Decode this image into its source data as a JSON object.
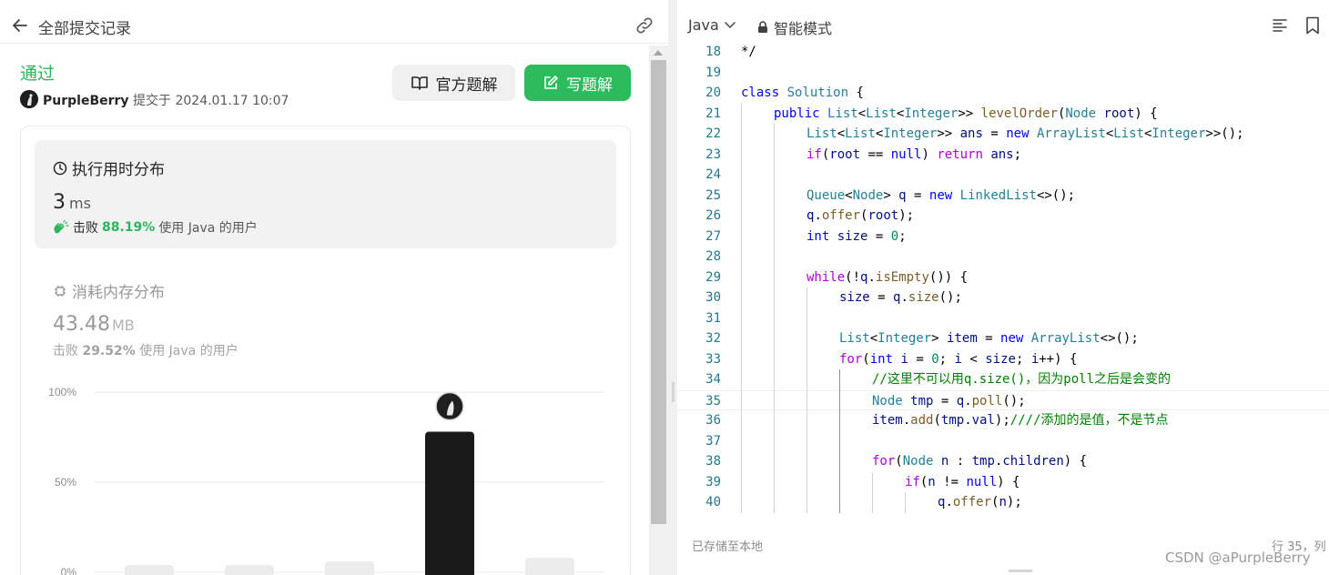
{
  "left": {
    "header_title": "全部提交记录",
    "status": "通过",
    "user_name": "PurpleBerry",
    "submitted_label": "提交于",
    "submitted_time": "2024.01.17 10:07",
    "btn_official": "官方题解",
    "btn_write": "写题解",
    "runtime": {
      "title": "执行用时分布",
      "value": "3",
      "unit": "ms",
      "beat_label": "击败",
      "beat_pct": "88.19%",
      "beat_suffix": "使用 Java 的用户"
    },
    "memory": {
      "title": "消耗内存分布",
      "value": "43.48",
      "unit": "MB",
      "beat_label": "击败",
      "beat_pct": "29.52%",
      "beat_suffix": "使用 Java 的用户"
    }
  },
  "chart_data": {
    "type": "bar",
    "ylim": [
      0,
      100
    ],
    "ytick_labels": [
      "100%",
      "50%",
      "0%"
    ],
    "yticks": [
      100,
      50,
      0
    ],
    "values": [
      4,
      4,
      6,
      78,
      8
    ],
    "highlight_index": 3,
    "colors": {
      "bar": "#ececec",
      "highlight": "#1a1a1a",
      "grid": "#ebebeb"
    }
  },
  "editor": {
    "language": "Java",
    "mode": "智能模式",
    "saved": "已存储至本地",
    "cursor": "行 35，列",
    "watermark": "CSDN @aPurpleBerry",
    "lines": [
      {
        "n": "18",
        "indent": 0,
        "t": [
          [
            "",
            "*/"
          ]
        ]
      },
      {
        "n": "19",
        "indent": 0,
        "t": []
      },
      {
        "n": "20",
        "indent": 0,
        "t": [
          [
            "kw",
            "class"
          ],
          [
            "",
            " "
          ],
          [
            "ty",
            "Solution"
          ],
          [
            "",
            " {"
          ]
        ]
      },
      {
        "n": "21",
        "indent": 1,
        "t": [
          [
            "kw",
            "public"
          ],
          [
            "",
            " "
          ],
          [
            "ty",
            "List"
          ],
          [
            "",
            "<"
          ],
          [
            "ty",
            "List"
          ],
          [
            "",
            "<"
          ],
          [
            "ty",
            "Integer"
          ],
          [
            "",
            ">> "
          ],
          [
            "fn",
            "levelOrder"
          ],
          [
            "",
            "("
          ],
          [
            "ty",
            "Node"
          ],
          [
            "",
            " "
          ],
          [
            "var",
            "root"
          ],
          [
            "",
            ") {"
          ]
        ]
      },
      {
        "n": "22",
        "indent": 2,
        "t": [
          [
            "ty",
            "List"
          ],
          [
            "",
            "<"
          ],
          [
            "ty",
            "List"
          ],
          [
            "",
            "<"
          ],
          [
            "ty",
            "Integer"
          ],
          [
            "",
            ">> "
          ],
          [
            "var",
            "ans"
          ],
          [
            "",
            " = "
          ],
          [
            "kw",
            "new"
          ],
          [
            "",
            " "
          ],
          [
            "ty",
            "ArrayList"
          ],
          [
            "",
            "<"
          ],
          [
            "ty",
            "List"
          ],
          [
            "",
            "<"
          ],
          [
            "ty",
            "Integer"
          ],
          [
            "",
            ">>();"
          ]
        ]
      },
      {
        "n": "23",
        "indent": 2,
        "t": [
          [
            "kw2",
            "if"
          ],
          [
            "",
            "("
          ],
          [
            "var",
            "root"
          ],
          [
            "",
            " == "
          ],
          [
            "kw",
            "null"
          ],
          [
            "",
            ") "
          ],
          [
            "kw2",
            "return"
          ],
          [
            "",
            " "
          ],
          [
            "var",
            "ans"
          ],
          [
            "",
            ";"
          ]
        ]
      },
      {
        "n": "24",
        "indent": 2,
        "t": []
      },
      {
        "n": "25",
        "indent": 2,
        "t": [
          [
            "ty",
            "Queue"
          ],
          [
            "",
            "<"
          ],
          [
            "ty",
            "Node"
          ],
          [
            "",
            "> "
          ],
          [
            "var",
            "q"
          ],
          [
            "",
            " = "
          ],
          [
            "kw",
            "new"
          ],
          [
            "",
            " "
          ],
          [
            "ty",
            "LinkedList"
          ],
          [
            "",
            "<>();"
          ]
        ]
      },
      {
        "n": "26",
        "indent": 2,
        "t": [
          [
            "var",
            "q"
          ],
          [
            "",
            "."
          ],
          [
            "fn",
            "offer"
          ],
          [
            "",
            "("
          ],
          [
            "var",
            "root"
          ],
          [
            "",
            ");"
          ]
        ]
      },
      {
        "n": "27",
        "indent": 2,
        "t": [
          [
            "kw",
            "int"
          ],
          [
            "",
            " "
          ],
          [
            "var",
            "size"
          ],
          [
            "",
            " = "
          ],
          [
            "num",
            "0"
          ],
          [
            "",
            ";"
          ]
        ]
      },
      {
        "n": "28",
        "indent": 2,
        "t": []
      },
      {
        "n": "29",
        "indent": 2,
        "t": [
          [
            "kw2",
            "while"
          ],
          [
            "",
            "(!"
          ],
          [
            "var",
            "q"
          ],
          [
            "",
            "."
          ],
          [
            "fn",
            "isEmpty"
          ],
          [
            "",
            "()) {"
          ]
        ]
      },
      {
        "n": "30",
        "indent": 3,
        "t": [
          [
            "var",
            "size"
          ],
          [
            "",
            " = "
          ],
          [
            "var",
            "q"
          ],
          [
            "",
            "."
          ],
          [
            "fn",
            "size"
          ],
          [
            "",
            "();"
          ]
        ]
      },
      {
        "n": "31",
        "indent": 3,
        "t": []
      },
      {
        "n": "32",
        "indent": 3,
        "t": [
          [
            "ty",
            "List"
          ],
          [
            "",
            "<"
          ],
          [
            "ty",
            "Integer"
          ],
          [
            "",
            "> "
          ],
          [
            "var",
            "item"
          ],
          [
            "",
            " = "
          ],
          [
            "kw",
            "new"
          ],
          [
            "",
            " "
          ],
          [
            "ty",
            "ArrayList"
          ],
          [
            "",
            "<>();"
          ]
        ]
      },
      {
        "n": "33",
        "indent": 3,
        "t": [
          [
            "kw2",
            "for"
          ],
          [
            "",
            "("
          ],
          [
            "kw",
            "int"
          ],
          [
            "",
            " "
          ],
          [
            "var",
            "i"
          ],
          [
            "",
            " = "
          ],
          [
            "num",
            "0"
          ],
          [
            "",
            "; "
          ],
          [
            "var",
            "i"
          ],
          [
            "",
            " < "
          ],
          [
            "var",
            "size"
          ],
          [
            "",
            "; "
          ],
          [
            "var",
            "i"
          ],
          [
            "",
            "++) {"
          ]
        ]
      },
      {
        "n": "34",
        "indent": 4,
        "t": [
          [
            "cm",
            "//这里不可以用q.size()，因为poll之后是会变的"
          ]
        ]
      },
      {
        "n": "35",
        "indent": 4,
        "t": [
          [
            "ty",
            "Node"
          ],
          [
            "",
            " "
          ],
          [
            "var",
            "tmp"
          ],
          [
            "",
            " = "
          ],
          [
            "var",
            "q"
          ],
          [
            "",
            "."
          ],
          [
            "fn",
            "poll"
          ],
          [
            "",
            "();"
          ]
        ]
      },
      {
        "n": "36",
        "indent": 4,
        "t": [
          [
            "var",
            "item"
          ],
          [
            "",
            "."
          ],
          [
            "fn",
            "add"
          ],
          [
            "",
            "("
          ],
          [
            "var",
            "tmp"
          ],
          [
            "",
            "."
          ],
          [
            "var",
            "val"
          ],
          [
            "",
            ");"
          ],
          [
            "cm",
            "////添加的是值，不是节点"
          ]
        ]
      },
      {
        "n": "37",
        "indent": 4,
        "t": []
      },
      {
        "n": "38",
        "indent": 4,
        "t": [
          [
            "kw2",
            "for"
          ],
          [
            "",
            "("
          ],
          [
            "ty",
            "Node"
          ],
          [
            "",
            " "
          ],
          [
            "var",
            "n"
          ],
          [
            "",
            " : "
          ],
          [
            "var",
            "tmp"
          ],
          [
            "",
            "."
          ],
          [
            "var",
            "children"
          ],
          [
            "",
            ") {"
          ]
        ]
      },
      {
        "n": "39",
        "indent": 5,
        "t": [
          [
            "kw2",
            "if"
          ],
          [
            "",
            "("
          ],
          [
            "var",
            "n"
          ],
          [
            "",
            " != "
          ],
          [
            "kw",
            "null"
          ],
          [
            "",
            ") {"
          ]
        ]
      },
      {
        "n": "40",
        "indent": 6,
        "t": [
          [
            "var",
            "q"
          ],
          [
            "",
            "."
          ],
          [
            "fn",
            "offer"
          ],
          [
            "",
            "("
          ],
          [
            "var",
            "n"
          ],
          [
            "",
            ");"
          ]
        ]
      }
    ]
  }
}
